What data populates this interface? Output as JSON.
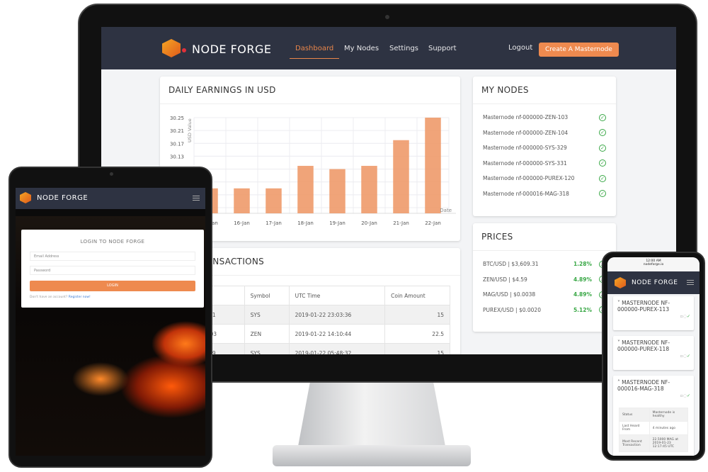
{
  "brand": "NODE FORGE",
  "nav": {
    "items": [
      "Dashboard",
      "My Nodes",
      "Settings",
      "Support"
    ],
    "active": "Dashboard",
    "logout": "Logout",
    "cta": "Create A Masternode"
  },
  "earnings": {
    "title": "DAILY EARNINGS IN USD"
  },
  "chart_data": {
    "type": "bar",
    "title": "DAILY EARNINGS IN USD",
    "xlabel": "Date",
    "ylabel": "USD Value",
    "categories": [
      "15-Jan",
      "16-Jan",
      "17-Jan",
      "18-Jan",
      "19-Jan",
      "20-Jan",
      "21-Jan",
      "22-Jan"
    ],
    "values": [
      30.03,
      30.03,
      30.03,
      30.1,
      30.09,
      30.1,
      30.18,
      30.25
    ],
    "yticks": [
      30.25,
      30.21,
      30.17,
      30.13
    ],
    "ylim": [
      29.97,
      30.25
    ],
    "grid": true,
    "color": "#ee9a6a"
  },
  "my_nodes": {
    "title": "MY NODES",
    "items": [
      "Masternode nf-000000-ZEN-103",
      "Masternode nf-000000-ZEN-104",
      "Masternode nf-000000-SYS-329",
      "Masternode nf-000000-SYS-331",
      "Masternode nf-000000-PUREX-120",
      "Masternode nf-000016-MAG-318"
    ]
  },
  "prices": {
    "title": "PRICES",
    "items": [
      {
        "pair": "BTC/USD | $3,609.31",
        "change": "1.28%"
      },
      {
        "pair": "ZEN/USD | $4.59",
        "change": "4.89%"
      },
      {
        "pair": "MAG/USD | $0.0038",
        "change": "4.89%"
      },
      {
        "pair": "PUREX/USD | $0.0020",
        "change": "5.12%"
      }
    ]
  },
  "transactions": {
    "title": "TRANSACTIONS",
    "columns": [
      "",
      "Symbol",
      "UTC Time",
      "Coin Amount"
    ],
    "rows": [
      [
        "00000-SYS-331",
        "SYS",
        "2019-01-22 23:03:36",
        "15"
      ],
      [
        "00000-ZEN-103",
        "ZEN",
        "2019-01-22 14:10:44",
        "22.5"
      ],
      [
        "00000-SYS-329",
        "SYS",
        "2019-01-22 05:48:32",
        "15"
      ]
    ]
  },
  "tablet": {
    "title": "LOGIN TO NODE FORGE",
    "email_placeholder": "Email Address",
    "password_placeholder": "Password",
    "login": "LOGIN",
    "no_account": "Don't have an account?",
    "register": "Register now!"
  },
  "phone": {
    "time": "12:00 AM",
    "url": "nodeforge.io",
    "nodes": [
      {
        "title": "MASTERNODE NF-000000-PUREX-113",
        "arrow": "˅"
      },
      {
        "title": "MASTERNODE NF-000000-PUREX-118",
        "arrow": "˅"
      },
      {
        "title": "MASTERNODE NF-000016-MAG-318",
        "arrow": "˄"
      }
    ],
    "details": [
      [
        "Status",
        "Masternode is healthy"
      ],
      [
        "Last Heard From",
        "4 minutes ago"
      ],
      [
        "Most Recent Transaction",
        "22.5000 MAG at 2019-01-23 12:17:45 UTC"
      ]
    ]
  }
}
